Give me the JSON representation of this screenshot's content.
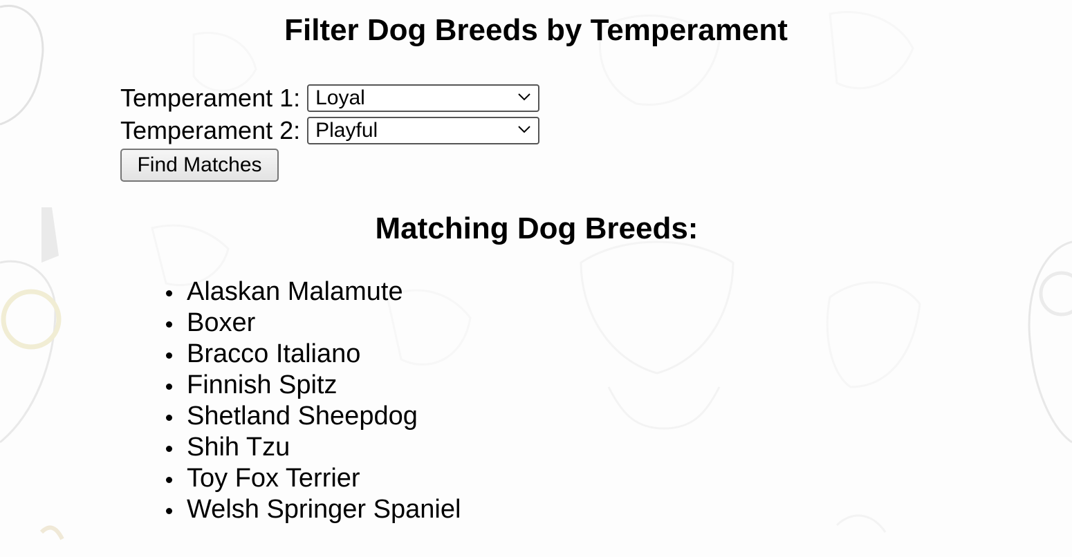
{
  "page": {
    "title": "Filter Dog Breeds by Temperament",
    "background_color": "#fdfdfd"
  },
  "form": {
    "temperament1": {
      "label": "Temperament 1:",
      "selected": "Loyal"
    },
    "temperament2": {
      "label": "Temperament 2:",
      "selected": "Playful"
    },
    "submit_label": "Find Matches"
  },
  "results": {
    "heading": "Matching Dog Breeds:",
    "breeds": [
      "Alaskan Malamute",
      "Boxer",
      "Bracco Italiano",
      "Finnish Spitz",
      "Shetland Sheepdog",
      "Shih Tzu",
      "Toy Fox Terrier",
      "Welsh Springer Spaniel"
    ]
  },
  "icons": {
    "select_chevron": "chevron-down-icon"
  }
}
